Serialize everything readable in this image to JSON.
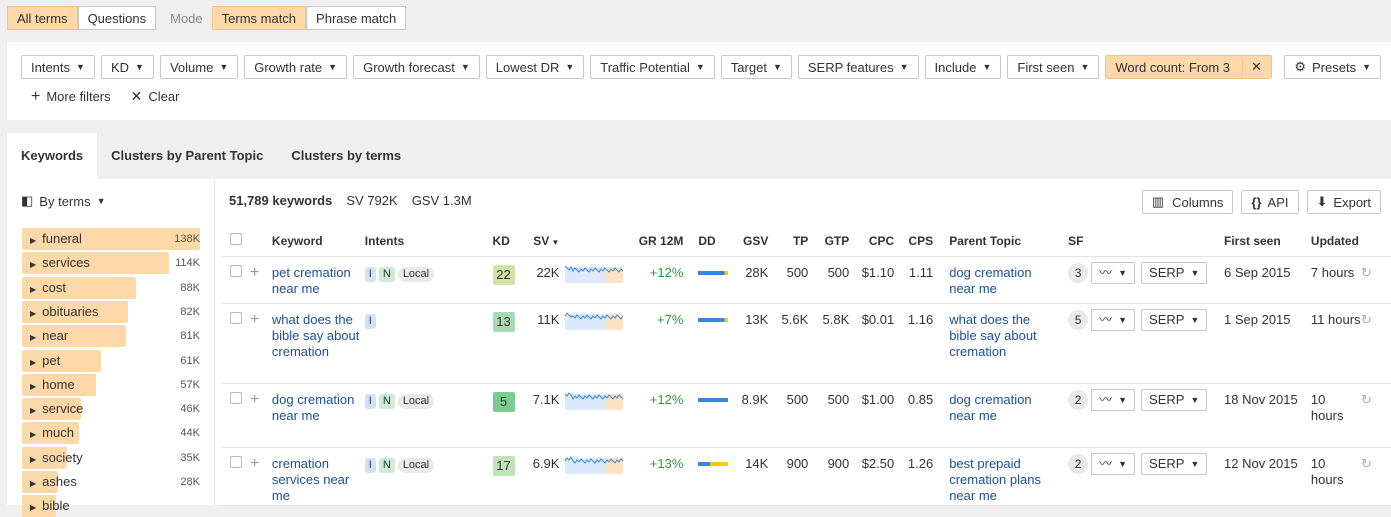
{
  "topbar": {
    "terms_tabs": [
      {
        "label": "All terms",
        "active": true
      },
      {
        "label": "Questions",
        "active": false
      }
    ],
    "mode_label": "Mode",
    "match_tabs": [
      {
        "label": "Terms match",
        "active": true
      },
      {
        "label": "Phrase match",
        "active": false
      }
    ]
  },
  "filters": {
    "items": [
      "Intents",
      "KD",
      "Volume",
      "Growth rate",
      "Growth forecast",
      "Lowest DR",
      "Traffic Potential",
      "Target",
      "SERP features",
      "Include",
      "First seen"
    ],
    "active_filter": "Word count: From 3",
    "presets": "Presets",
    "more_filters": "More filters",
    "clear": "Clear"
  },
  "tabs": [
    {
      "label": "Keywords",
      "active": true
    },
    {
      "label": "Clusters by Parent Topic",
      "active": false
    },
    {
      "label": "Clusters by terms",
      "active": false
    }
  ],
  "sidebar": {
    "group_by": "By terms",
    "terms": [
      {
        "label": "funeral",
        "count": "138K",
        "value": 138
      },
      {
        "label": "services",
        "count": "114K",
        "value": 114
      },
      {
        "label": "cost",
        "count": "88K",
        "value": 88
      },
      {
        "label": "obituaries",
        "count": "82K",
        "value": 82
      },
      {
        "label": "near",
        "count": "81K",
        "value": 81
      },
      {
        "label": "pet",
        "count": "61K",
        "value": 61
      },
      {
        "label": "home",
        "count": "57K",
        "value": 57
      },
      {
        "label": "service",
        "count": "46K",
        "value": 46
      },
      {
        "label": "much",
        "count": "44K",
        "value": 44
      },
      {
        "label": "society",
        "count": "35K",
        "value": 35
      },
      {
        "label": "ashes",
        "count": "28K",
        "value": 28
      },
      {
        "label": "bible",
        "count": "",
        "value": 26
      }
    ]
  },
  "summary": {
    "keywords": "51,789 keywords",
    "sv": "SV 792K",
    "gsv": "GSV 1.3M"
  },
  "toolbar": {
    "columns": "Columns",
    "api": "API",
    "export": "Export"
  },
  "table": {
    "headers": {
      "keyword": "Keyword",
      "intents": "Intents",
      "kd": "KD",
      "sv": "SV",
      "gr": "GR 12M",
      "dd": "DD",
      "gsv": "GSV",
      "tp": "TP",
      "gtp": "GTP",
      "cpc": "CPC",
      "cps": "CPS",
      "parent": "Parent Topic",
      "sf": "SF",
      "first_seen": "First seen",
      "updated": "Updated"
    },
    "serp_label": "SERP",
    "rows": [
      {
        "keyword": "pet cremation near me",
        "intents": [
          "I",
          "N",
          "Local"
        ],
        "kd": "22",
        "kd_color": "#cfe3a4",
        "sv": "22K",
        "gr": "+12%",
        "dd": [
          0.88,
          0.12
        ],
        "gsv": "28K",
        "tp": "500",
        "gtp": "500",
        "cpc": "$1.10",
        "cps": "1.11",
        "parent": "dog cremation near me",
        "sf": "3",
        "first_seen": "6 Sep 2015",
        "updated": "7 hours"
      },
      {
        "keyword": "what does the bible say about cremation",
        "intents": [
          "I"
        ],
        "kd": "13",
        "kd_color": "#a8dbb4",
        "sv": "11K",
        "gr": "+7%",
        "dd": [
          0.88,
          0.12
        ],
        "gsv": "13K",
        "tp": "5.6K",
        "gtp": "5.8K",
        "cpc": "$0.01",
        "cps": "1.16",
        "parent": "what does the bible say about cremation",
        "sf": "5",
        "first_seen": "1 Sep 2015",
        "updated": "11 hours"
      },
      {
        "keyword": "dog cremation near me",
        "intents": [
          "I",
          "N",
          "Local"
        ],
        "kd": "5",
        "kd_color": "#7ccc8f",
        "sv": "7.1K",
        "gr": "+12%",
        "dd": [
          1,
          0
        ],
        "gsv": "8.9K",
        "tp": "500",
        "gtp": "500",
        "cpc": "$1.00",
        "cps": "0.85",
        "parent": "dog cremation near me",
        "sf": "2",
        "first_seen": "18 Nov 2015",
        "updated": "10 hours"
      },
      {
        "keyword": "cremation services near me",
        "intents": [
          "I",
          "N",
          "Local"
        ],
        "kd": "17",
        "kd_color": "#bfe3b4",
        "sv": "6.9K",
        "gr": "+13%",
        "dd": [
          0.4,
          0.6
        ],
        "gsv": "14K",
        "tp": "900",
        "gtp": "900",
        "cpc": "$2.50",
        "cps": "1.26",
        "parent": "best prepaid cremation plans near me",
        "sf": "2",
        "first_seen": "12 Nov 2015",
        "updated": "10 hours"
      }
    ]
  },
  "colors": {
    "accent": "#fdd9aa",
    "link": "#1a4f9c",
    "growth": "#2a9a3a",
    "dd_blue": "#3a86d6",
    "dd_yellow": "#f2c811"
  }
}
